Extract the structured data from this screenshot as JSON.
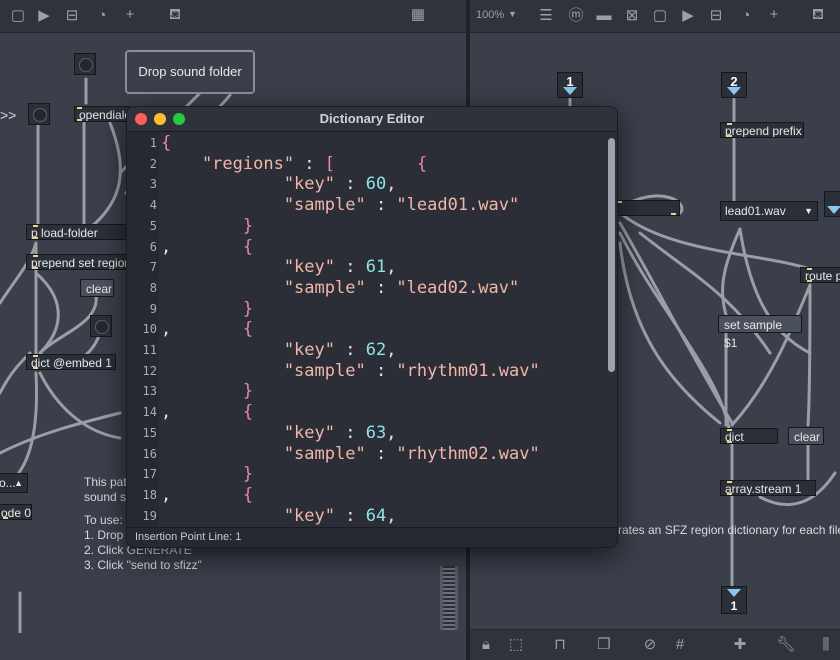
{
  "left_patch": {
    "drop_zone_label": "Drop sound folder",
    "arrow_label": ">>",
    "objects": {
      "opendialog": "opendialo",
      "load_folder": "p load-folder",
      "prepend": "prepend set region",
      "clear": "clear",
      "dict_embed": "dict @embed 1",
      "mode_obj": "o...",
      "mode0": "ode 0"
    },
    "comment_lines": [
      "This pat",
      "sound s",
      "",
      "To use:",
      "1. Drop",
      "2. Click GENERATE",
      "3. Click \"send to sfizz\""
    ]
  },
  "right_patch": {
    "zoom": "100%",
    "inlet_1": "1",
    "inlet_2": "2",
    "outlet_1": "1",
    "objects": {
      "prepend_prefix": "prepend prefix",
      "route": "route p",
      "set_sample": "set sample $1",
      "dict": "dict",
      "clear": "clear",
      "array_stream": "array.stream 1"
    },
    "umenu_value": "lead01.wav",
    "comment": "rates an SFZ region dictionary for each file"
  },
  "dict_editor": {
    "title": "Dictionary Editor",
    "status": "Insertion Point Line: 1",
    "line_numbers": [
      "1",
      "2",
      "3",
      "4",
      "5",
      "6",
      "7",
      "8",
      "9",
      "10",
      "11",
      "12",
      "13",
      "14",
      "15",
      "16",
      "17",
      "18",
      "19"
    ],
    "lines": [
      [
        {
          "t": "{",
          "c": "brace"
        }
      ],
      [
        {
          "t": "    \"regions\"",
          "c": "key"
        },
        {
          "t": " : ",
          "c": "punc"
        },
        {
          "t": "[",
          "c": "brace"
        },
        {
          "t": "        {",
          "c": "brace"
        }
      ],
      [
        {
          "t": "            \"key\"",
          "c": "key"
        },
        {
          "t": " : ",
          "c": "punc"
        },
        {
          "t": "60",
          "c": "num"
        },
        {
          "t": ",",
          "c": "punc"
        }
      ],
      [
        {
          "t": "            \"sample\"",
          "c": "key"
        },
        {
          "t": " : ",
          "c": "punc"
        },
        {
          "t": "\"lead01.wav\"",
          "c": "str"
        }
      ],
      [
        {
          "t": "        }",
          "c": "brace"
        }
      ],
      [
        {
          "t": ",",
          "c": "punc"
        },
        {
          "t": "       {",
          "c": "brace"
        }
      ],
      [
        {
          "t": "            \"key\"",
          "c": "key"
        },
        {
          "t": " : ",
          "c": "punc"
        },
        {
          "t": "61",
          "c": "num"
        },
        {
          "t": ",",
          "c": "punc"
        }
      ],
      [
        {
          "t": "            \"sample\"",
          "c": "key"
        },
        {
          "t": " : ",
          "c": "punc"
        },
        {
          "t": "\"lead02.wav\"",
          "c": "str"
        }
      ],
      [
        {
          "t": "        }",
          "c": "brace"
        }
      ],
      [
        {
          "t": ",",
          "c": "punc"
        },
        {
          "t": "       {",
          "c": "brace"
        }
      ],
      [
        {
          "t": "            \"key\"",
          "c": "key"
        },
        {
          "t": " : ",
          "c": "punc"
        },
        {
          "t": "62",
          "c": "num"
        },
        {
          "t": ",",
          "c": "punc"
        }
      ],
      [
        {
          "t": "            \"sample\"",
          "c": "key"
        },
        {
          "t": " : ",
          "c": "punc"
        },
        {
          "t": "\"rhythm01.wav\"",
          "c": "str"
        }
      ],
      [
        {
          "t": "        }",
          "c": "brace"
        }
      ],
      [
        {
          "t": ",",
          "c": "punc"
        },
        {
          "t": "       {",
          "c": "brace"
        }
      ],
      [
        {
          "t": "            \"key\"",
          "c": "key"
        },
        {
          "t": " : ",
          "c": "punc"
        },
        {
          "t": "63",
          "c": "num"
        },
        {
          "t": ",",
          "c": "punc"
        }
      ],
      [
        {
          "t": "            \"sample\"",
          "c": "key"
        },
        {
          "t": " : ",
          "c": "punc"
        },
        {
          "t": "\"rhythm02.wav\"",
          "c": "str"
        }
      ],
      [
        {
          "t": "        }",
          "c": "brace"
        }
      ],
      [
        {
          "t": ",",
          "c": "punc"
        },
        {
          "t": "       {",
          "c": "brace"
        }
      ],
      [
        {
          "t": "            \"key\"",
          "c": "key"
        },
        {
          "t": " : ",
          "c": "punc"
        },
        {
          "t": "64",
          "c": "num"
        },
        {
          "t": ",",
          "c": "punc"
        }
      ]
    ]
  },
  "colors": {
    "traffic_close": "#fe5f57",
    "traffic_min": "#febc2e",
    "traffic_max": "#28c840"
  }
}
